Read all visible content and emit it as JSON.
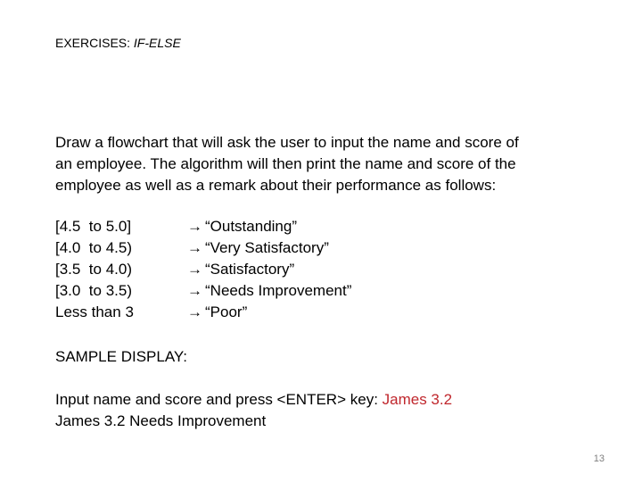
{
  "slide": {
    "title_prefix": "EXERCISES: ",
    "title_italic": "IF-ELSE",
    "instructions": [
      "Draw a flowchart that will ask the user to input the name and score of",
      "an employee. The algorithm will then print the name and score of the",
      "employee as well as a remark about their performance as follows:"
    ],
    "arrow_glyph": "→",
    "ranges": [
      {
        "range": "[4.5  to 5.0]",
        "remark": "“Outstanding”"
      },
      {
        "range": "[4.0  to 4.5)",
        "remark": "“Very Satisfactory”"
      },
      {
        "range": "[3.5  to 4.0)",
        "remark": "“Satisfactory”"
      },
      {
        "range": "[3.0  to 3.5)",
        "remark": "“Needs Improvement”"
      },
      {
        "range": "Less than 3",
        "remark": "“Poor”"
      }
    ],
    "sample_heading": "SAMPLE DISPLAY:",
    "sample_prompt": "Input name and score and press <ENTER> key: ",
    "sample_input": "James 3.2",
    "sample_output": "James 3.2 Needs Improvement",
    "page_number": "13",
    "colors": {
      "user_input": "#c0272d",
      "page_number": "#7f7f7f"
    }
  }
}
